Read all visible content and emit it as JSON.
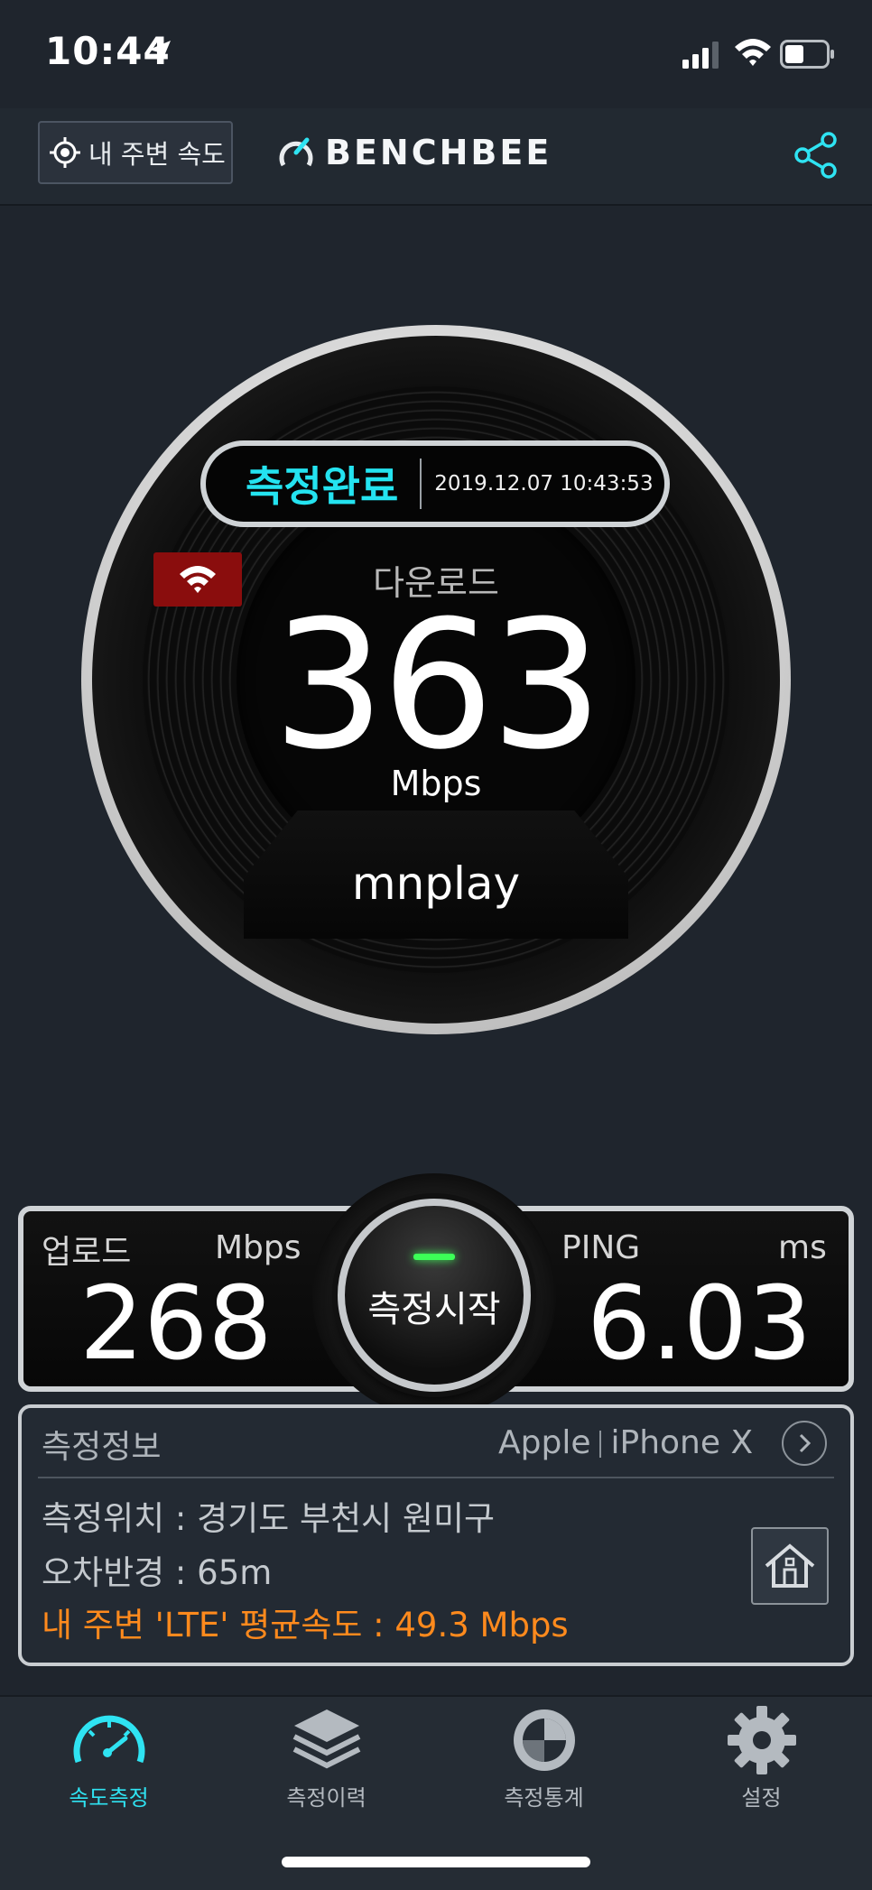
{
  "status_bar": {
    "time": "10:44"
  },
  "header": {
    "nearby_button": "내 주변 속도",
    "brand": "BENCHBEE"
  },
  "gauge": {
    "status": "측정완료",
    "timestamp": "2019.12.07 10:43:53",
    "download_label": "다운로드",
    "download_value": "363",
    "download_unit": "Mbps",
    "server": "mnplay"
  },
  "metrics": {
    "upload_label": "업로드",
    "upload_unit": "Mbps",
    "upload_value": "268",
    "ping_label": "PING",
    "ping_unit": "ms",
    "ping_value": "6.03",
    "start_button": "측정시작"
  },
  "info": {
    "title": "측정정보",
    "device_brand": "Apple",
    "device_model": "iPhone X",
    "location": "측정위치 : 경기도 부천시 원미구",
    "error_radius": "오차반경 : 65m",
    "nearby_average": "내 주변 'LTE' 평균속도 : 49.3 Mbps"
  },
  "nav": {
    "items": [
      {
        "label": "속도측정",
        "icon": "speedometer-icon",
        "active": true
      },
      {
        "label": "측정이력",
        "icon": "layers-icon",
        "active": false
      },
      {
        "label": "측정통계",
        "icon": "statistics-icon",
        "active": false
      },
      {
        "label": "설정",
        "icon": "gear-icon",
        "active": false
      }
    ]
  },
  "colors": {
    "accent": "#2fe3f2",
    "orange": "#ff8a1d",
    "background": "#1f252d",
    "wifi_badge": "#8a0d0d",
    "led": "#3cff57"
  }
}
